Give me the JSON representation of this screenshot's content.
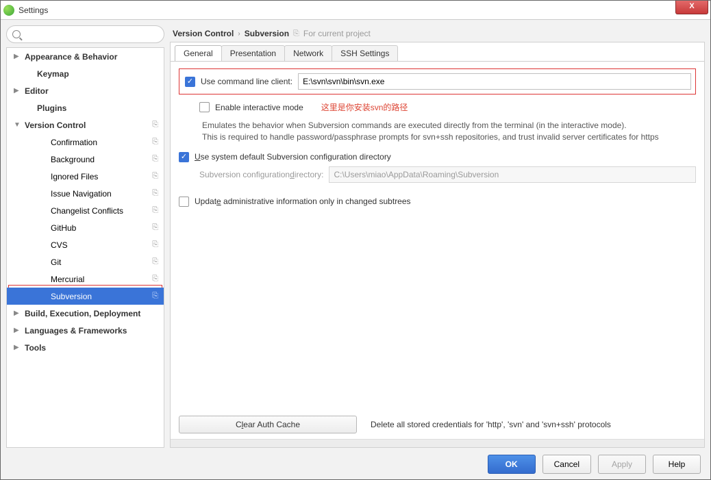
{
  "window": {
    "title": "Settings",
    "close_label": "X"
  },
  "search": {
    "placeholder": ""
  },
  "tree": {
    "items": [
      {
        "label": "Appearance & Behavior",
        "level": 0,
        "arrow": "▶",
        "bold": true
      },
      {
        "label": "Keymap",
        "level": 1,
        "bold": true
      },
      {
        "label": "Editor",
        "level": 0,
        "arrow": "▶",
        "bold": true
      },
      {
        "label": "Plugins",
        "level": 1,
        "bold": true
      },
      {
        "label": "Version Control",
        "level": 0,
        "arrow": "▼",
        "bold": true,
        "copy": true
      },
      {
        "label": "Confirmation",
        "level": 2,
        "copy": true
      },
      {
        "label": "Background",
        "level": 2,
        "copy": true
      },
      {
        "label": "Ignored Files",
        "level": 2,
        "copy": true
      },
      {
        "label": "Issue Navigation",
        "level": 2,
        "copy": true
      },
      {
        "label": "Changelist Conflicts",
        "level": 2,
        "copy": true
      },
      {
        "label": "GitHub",
        "level": 2,
        "copy": true
      },
      {
        "label": "CVS",
        "level": 2,
        "copy": true
      },
      {
        "label": "Git",
        "level": 2,
        "copy": true
      },
      {
        "label": "Mercurial",
        "level": 2,
        "copy": true
      },
      {
        "label": "Subversion",
        "level": 2,
        "copy": true,
        "selected": true
      },
      {
        "label": "Build, Execution, Deployment",
        "level": 0,
        "arrow": "▶",
        "bold": true
      },
      {
        "label": "Languages & Frameworks",
        "level": 0,
        "arrow": "▶",
        "bold": true
      },
      {
        "label": "Tools",
        "level": 0,
        "arrow": "▶",
        "bold": true
      }
    ]
  },
  "breadcrumb": {
    "a": "Version Control",
    "b": "Subversion",
    "hint": "For current project"
  },
  "tabs": [
    "General",
    "Presentation",
    "Network",
    "SSH Settings"
  ],
  "form": {
    "use_cli_label": "Use command line client:",
    "cli_path": "E:\\svn\\svn\\bin\\svn.exe",
    "enable_interactive_label": "Enable interactive mode",
    "annotation": "这里是你安装svn的路径",
    "desc1": "Emulates the behavior when Subversion commands are executed directly from the terminal (in the interactive mode).",
    "desc2": "This is required to handle password/passphrase prompts for svn+ssh repositories, and trust invalid server certificates for https",
    "use_sys_dir_pre": "U",
    "use_sys_dir_rest": "se system default Subversion configuration directory",
    "dir_label_pre": "Subversion configuration ",
    "dir_label_u": "d",
    "dir_label_post": "irectory:",
    "dir_value": "C:\\Users\\miao\\AppData\\Roaming\\Subversion",
    "update_pre": "Updat",
    "update_u": "e",
    "update_post": " administrative information only in changed subtrees",
    "clear_pre": "C",
    "clear_u": "l",
    "clear_post": "ear Auth Cache",
    "clear_desc": "Delete all stored credentials for 'http', 'svn' and 'svn+ssh' protocols"
  },
  "footer": {
    "ok": "OK",
    "cancel": "Cancel",
    "apply": "Apply",
    "help": "Help"
  }
}
